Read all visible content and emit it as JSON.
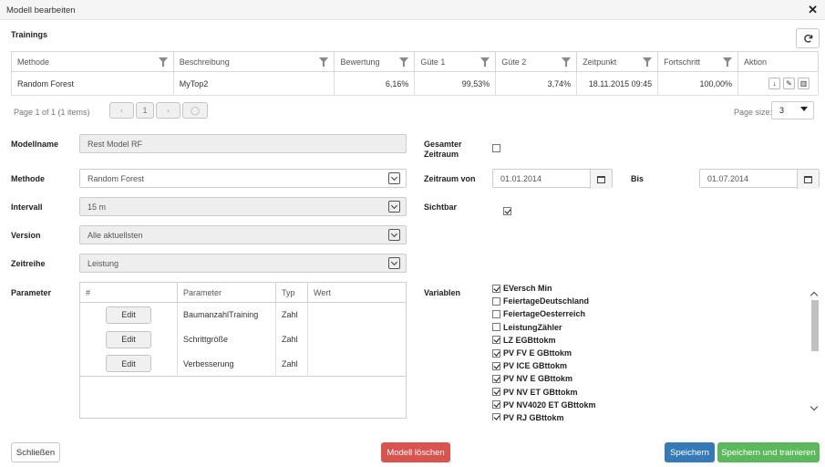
{
  "window": {
    "title": "Modell bearbeiten",
    "close": "✕"
  },
  "trainings": {
    "heading": "Trainings",
    "columns": [
      "Methode",
      "Beschreibung",
      "Bewertung",
      "Güte 1",
      "Güte 2",
      "Zeitpunkt",
      "Fortschritt",
      "Aktion"
    ],
    "rows": [
      {
        "methode": "Random Forest",
        "beschreibung": "MyTop2",
        "bewertung": "6,16%",
        "guete1": "99,53%",
        "guete2": "3,74%",
        "zeitpunkt": "18.11.2015 09:45",
        "fortschritt": "100,00%"
      }
    ],
    "pager": {
      "info": "Page 1 of 1 (1 items)",
      "current_page": "1",
      "page_size_label": "Page size:",
      "page_size": "3"
    }
  },
  "form": {
    "modellname": {
      "label": "Modellname",
      "value": "Rest Model RF"
    },
    "methode": {
      "label": "Methode",
      "value": "Random Forest"
    },
    "intervall": {
      "label": "Intervall",
      "value": "15 m"
    },
    "version": {
      "label": "Version",
      "value": "Alle aktuellsten"
    },
    "zeitreihe": {
      "label": "Zeitreihe",
      "value": "Leistung"
    },
    "parameter": {
      "label": "Parameter",
      "columns": [
        "#",
        "Parameter",
        "Typ",
        "Wert"
      ],
      "edit_label": "Edit",
      "rows": [
        {
          "name": "BaumanzahlTraining",
          "typ": "Zahl",
          "wert": ""
        },
        {
          "name": "Schrittgröße",
          "typ": "Zahl",
          "wert": ""
        },
        {
          "name": "Verbesserung",
          "typ": "Zahl",
          "wert": ""
        }
      ]
    },
    "gesamter_zeitraum": {
      "label_line1": "Gesamter",
      "label_line2": "Zeitraum",
      "checked": false
    },
    "zeitraum_von": {
      "label": "Zeitraum von",
      "value": "01.01.2014"
    },
    "bis": {
      "label": "Bis",
      "value": "01.07.2014"
    },
    "sichtbar": {
      "label": "Sichtbar",
      "checked": true
    },
    "variablen": {
      "label": "Variablen",
      "items": [
        {
          "name": "EVersch Min",
          "checked": true
        },
        {
          "name": "FeiertageDeutschland",
          "checked": false
        },
        {
          "name": "FeiertageOesterreich",
          "checked": false
        },
        {
          "name": "LeistungZähler",
          "checked": false
        },
        {
          "name": "LZ EGBttokm",
          "checked": true
        },
        {
          "name": "PV FV E GBttokm",
          "checked": true
        },
        {
          "name": "PV ICE GBttokm",
          "checked": true
        },
        {
          "name": "PV NV E GBttokm",
          "checked": true
        },
        {
          "name": "PV NV ET GBttokm",
          "checked": true
        },
        {
          "name": "PV NV4020 ET GBttokm",
          "checked": true
        },
        {
          "name": "PV RJ GBttokm",
          "checked": true
        }
      ]
    }
  },
  "footer": {
    "close": "Schließen",
    "delete": "Modell löschen",
    "save": "Speichern",
    "save_train": "Speichern und trainieren"
  },
  "colors": {
    "danger": "#d9534f",
    "primary": "#337ab7",
    "success": "#5cb85c"
  }
}
